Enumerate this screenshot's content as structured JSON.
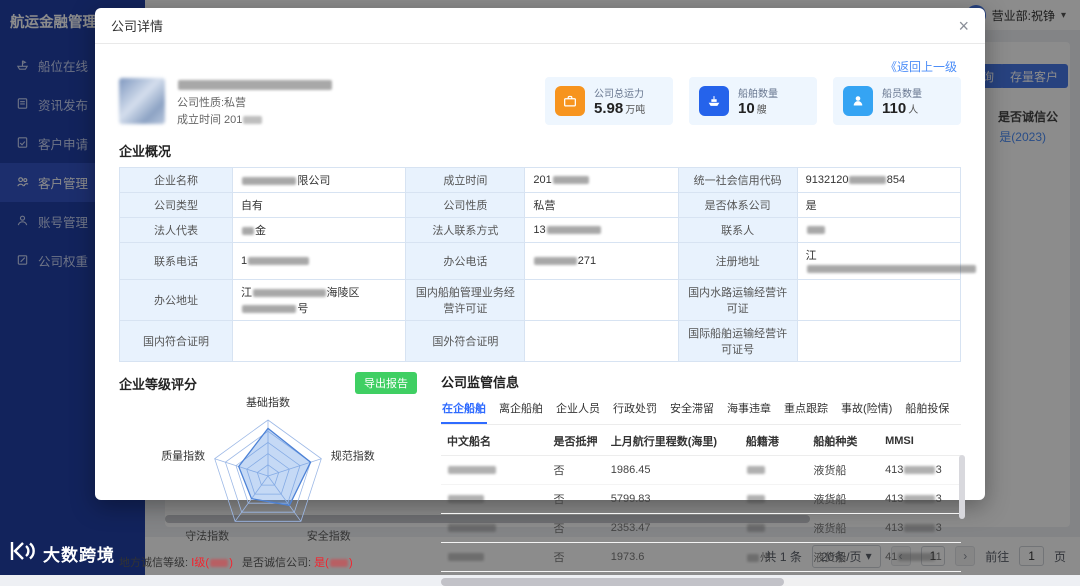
{
  "app": {
    "title": "航运金融管理",
    "brand": "大数跨境"
  },
  "header": {
    "user": "营业部:祝铮",
    "caret": "▾"
  },
  "sidebar": {
    "items": [
      {
        "label": "船位在线"
      },
      {
        "label": "资讯发布"
      },
      {
        "label": "客户申请"
      },
      {
        "label": "客户管理"
      },
      {
        "label": "账号管理"
      },
      {
        "label": "公司权重"
      }
    ]
  },
  "background": {
    "query_button": "询",
    "stock_button": "存量客户",
    "col_header": "是否诚信公",
    "col_value": "是(2023)",
    "pagination": {
      "total": "共 1 条",
      "page_size": "20条/页",
      "prev": "‹",
      "next": "›",
      "current": "1",
      "goto": "前往",
      "goto_value": "1",
      "page": "页"
    }
  },
  "modal": {
    "title": "公司详情",
    "close": "×",
    "back_link": "《返回上一级",
    "company": {
      "name": "████████████████████",
      "nature": "公司性质:私营",
      "founded": "成立时间 201███"
    },
    "stats": [
      {
        "label": "公司总运力",
        "value": "5.98",
        "unit": "万吨"
      },
      {
        "label": "船舶数量",
        "value": "10",
        "unit": "艘"
      },
      {
        "label": "船员数量",
        "value": "110",
        "unit": "人"
      }
    ],
    "overview": {
      "title": "企业概况",
      "rows": [
        [
          {
            "label": "企业名称",
            "value": "█████████限公司"
          },
          {
            "label": "成立时间",
            "value": "201██████"
          },
          {
            "label": "统一社会信用代码",
            "value": "9132120██████854"
          }
        ],
        [
          {
            "label": "公司类型",
            "value": "自有"
          },
          {
            "label": "公司性质",
            "value": "私营"
          },
          {
            "label": "是否体系公司",
            "value": "是"
          }
        ],
        [
          {
            "label": "法人代表",
            "value": "██金"
          },
          {
            "label": "法人联系方式",
            "value": "13█████████"
          },
          {
            "label": "联系人",
            "value": "███"
          }
        ],
        [
          {
            "label": "联系电话",
            "value": "1██████████"
          },
          {
            "label": "办公电话",
            "value": "███████271"
          },
          {
            "label": "注册地址",
            "value": "江████████████████████████████"
          }
        ],
        [
          {
            "label": "办公地址",
            "value": "江████████████海陵区█████████号"
          },
          {
            "label": "国内船舶管理业务经营许可证",
            "value": ""
          },
          {
            "label": "国内水路运输经营许可证",
            "value": ""
          }
        ],
        [
          {
            "label": "国内符合证明",
            "value": ""
          },
          {
            "label": "国外符合证明",
            "value": ""
          },
          {
            "label": "国际船舶运输经营许可证号",
            "value": ""
          }
        ]
      ]
    },
    "rating": {
      "title": "企业等级评分",
      "export_button": "导出报告",
      "credit_local_label": "地方诚信等级:",
      "credit_local_value": "Ⅰ级(███)",
      "credit_company_label": "是否诚信公司:",
      "credit_company_value": "是(███)"
    },
    "regulatory": {
      "title": "公司监管信息",
      "tabs": [
        "在企船舶",
        "离企船舶",
        "企业人员",
        "行政处罚",
        "安全滞留",
        "海事违章",
        "重点跟踪",
        "事故(险情)",
        "船舶投保"
      ],
      "table": {
        "headers": [
          "中文船名",
          "是否抵押",
          "上月航行里程数(海里)",
          "船籍港",
          "船舶种类",
          "MMSI"
        ],
        "rows": [
          [
            "████████",
            "否",
            "1986.45",
            "███",
            "液货船",
            "413█████3"
          ],
          [
            "██████",
            "否",
            "5799.83",
            "███",
            "液货船",
            "413█████3"
          ],
          [
            "████████",
            "否",
            "2353.47",
            "███",
            "液货船",
            "413█████3"
          ],
          [
            "██████",
            "否",
            "1973.6",
            "██州",
            "液货船",
            "41██████1"
          ]
        ]
      }
    }
  },
  "chart_data": {
    "type": "radar",
    "title": "企业等级评分",
    "categories": [
      "基础指数",
      "规范指数",
      "安全指数",
      "守法指数",
      "质量指数"
    ],
    "values": [
      85,
      80,
      65,
      50,
      55
    ],
    "max": 100,
    "levels": 5,
    "legend": "none",
    "grid": "spiderweb"
  },
  "colors": {
    "sidebar": "#2240a8",
    "accent_orange": "#f7941e",
    "accent_blue": "#2563eb",
    "accent_sky": "#35a4f3",
    "link": "#4b8df8",
    "danger": "#f5222d",
    "success": "#3fcf63",
    "tab_active": "#2f6bff"
  }
}
